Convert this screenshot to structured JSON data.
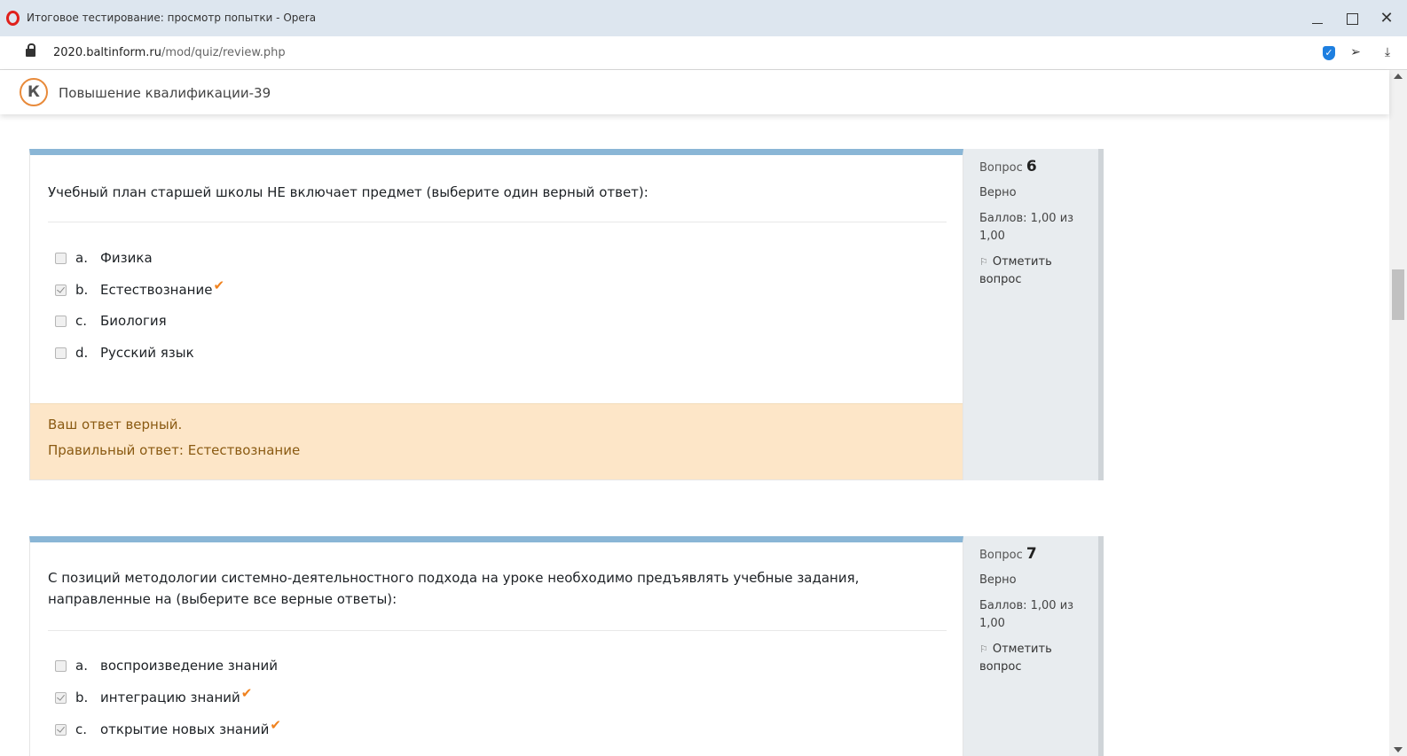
{
  "window": {
    "title": "Итоговое тестирование: просмотр попытки - Opera",
    "close_glyph": "✕"
  },
  "address": {
    "host": "2020.baltinform.ru",
    "path": "/mod/quiz/review.php"
  },
  "site": {
    "logo_letter": "К",
    "title": "Повышение квалификации-39"
  },
  "colors": {
    "accent_blue": "#8ab6d6",
    "tick_orange": "#f0821e",
    "feedback_bg": "#fde6c8",
    "info_bg": "#e8ecef"
  },
  "questions": [
    {
      "info": {
        "label": "Вопрос",
        "number": "6",
        "state": "Верно",
        "grade": "Баллов: 1,00 из 1,00",
        "flag_label": "Отметить вопрос"
      },
      "text": "Учебный план старшей школы НЕ включает предмет (выберите один верный ответ):",
      "answers": [
        {
          "letter": "a.",
          "text": "Физика",
          "checked": false,
          "tick": false
        },
        {
          "letter": "b.",
          "text": "Естествознание",
          "checked": true,
          "tick": true
        },
        {
          "letter": "c.",
          "text": "Биология",
          "checked": false,
          "tick": false
        },
        {
          "letter": "d.",
          "text": "Русский язык",
          "checked": false,
          "tick": false
        }
      ],
      "feedback": {
        "line1": "Ваш ответ верный.",
        "line2": "Правильный ответ: Естествознание"
      }
    },
    {
      "info": {
        "label": "Вопрос",
        "number": "7",
        "state": "Верно",
        "grade": "Баллов: 1,00 из 1,00",
        "flag_label": "Отметить вопрос"
      },
      "text": "С позиций методологии системно-деятельностного подхода на уроке необходимо предъявлять учебные задания, направленные на (выберите все верные ответы):",
      "answers": [
        {
          "letter": "a.",
          "text": "воспроизведение знаний",
          "checked": false,
          "tick": false
        },
        {
          "letter": "b.",
          "text": "интеграцию знаний",
          "checked": true,
          "tick": true
        },
        {
          "letter": "c.",
          "text": "открытие новых знаний",
          "checked": true,
          "tick": true
        }
      ]
    }
  ]
}
